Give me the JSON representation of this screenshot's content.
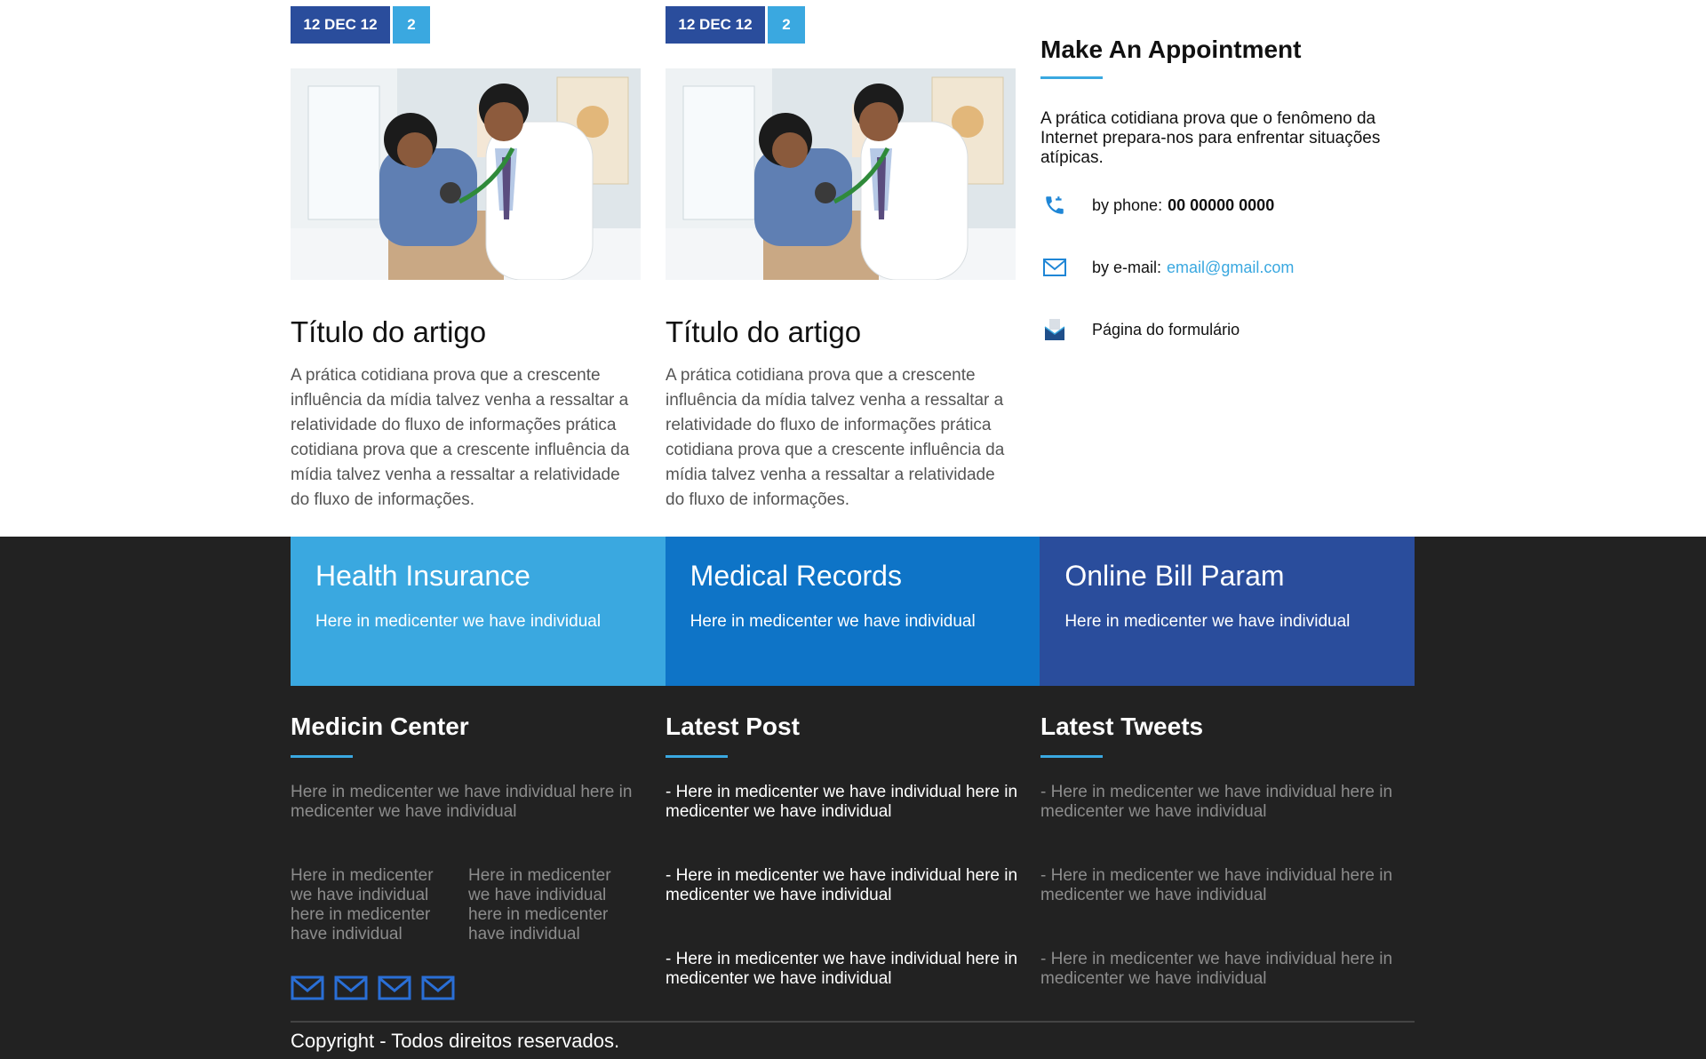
{
  "articles": [
    {
      "date": "12 DEC 12",
      "comments": "2",
      "title": "Título do artigo",
      "text": "A prática cotidiana prova que a crescente influência da mídia talvez venha a ressaltar a relatividade do fluxo de informações prática cotidiana prova que a crescente influência da mídia talvez venha a ressaltar a relatividade do fluxo de informações."
    },
    {
      "date": "12 DEC 12",
      "comments": "2",
      "title": "Título do artigo",
      "text": "A prática cotidiana prova que a crescente influência da mídia talvez venha a ressaltar a relatividade do fluxo de informações prática cotidiana prova que a crescente influência da mídia talvez venha a ressaltar a relatividade do fluxo de informações."
    }
  ],
  "appointment": {
    "title": "Make An Appointment",
    "lead": "A prática cotidiana prova que o fenômeno da Internet prepara-nos para enfrentar situações atípicas.",
    "phone_label": "by phone:",
    "phone_value": "00 00000 0000",
    "email_label": "by e-mail:",
    "email_value": "email@gmail.com",
    "form_label": "Página do formulário"
  },
  "tiles": [
    {
      "title": "Health Insurance",
      "text": "Here in medicenter we have individual"
    },
    {
      "title": "Medical Records",
      "text": "Here in medicenter we have individual"
    },
    {
      "title": "Online Bill Param",
      "text": "Here in medicenter we have individual"
    }
  ],
  "footer": {
    "medicin": {
      "title": "Medicin Center",
      "text": "Here in medicenter we have individual here in medicenter we have individual",
      "col_a": "Here in medicenter we have individual here in medicenter have individual",
      "col_b": "Here in medicenter we have individual here in medicenter have individual"
    },
    "latest_post": {
      "title": "Latest Post",
      "items": [
        "- Here in medicenter we have individual here in medicenter we have individual",
        "- Here in medicenter we have individual here in medicenter we have individual",
        "- Here in medicenter we have individual here in medicenter we have individual"
      ]
    },
    "latest_tweets": {
      "title": "Latest Tweets",
      "items": [
        "- Here in medicenter we have individual here in medicenter we have individual",
        "- Here in medicenter we have individual here in medicenter we have individual",
        "- Here in medicenter we have individual here in medicenter we have individual"
      ]
    },
    "copyright": "Copyright - Todos direitos reservados."
  },
  "colors": {
    "primary_dark": "#2a4d9c",
    "primary_light": "#3aa8e0",
    "primary_mid": "#0e74c7",
    "footer_bg": "#222222"
  },
  "icons": [
    "phone-icon",
    "mail-icon",
    "envelope-form-icon",
    "mail-social-icon"
  ]
}
